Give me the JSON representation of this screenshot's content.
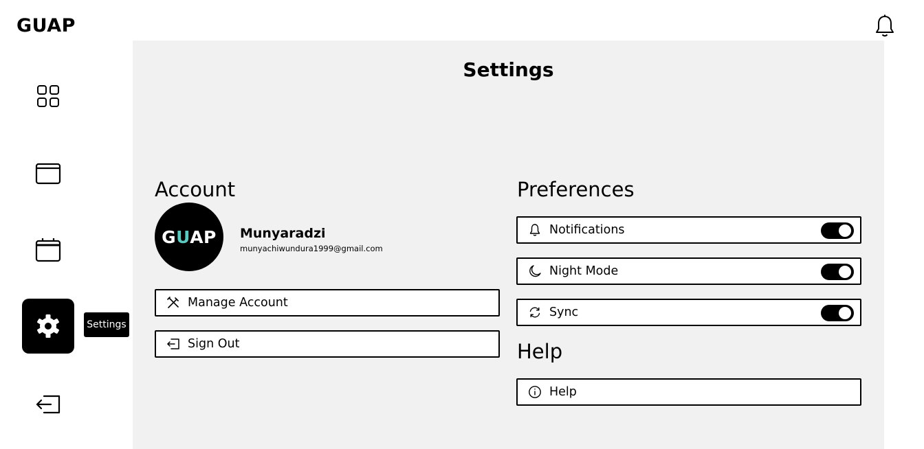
{
  "app": {
    "brand": "GUAP"
  },
  "sidebar": {
    "items": [
      {
        "icon": "dashboard-grid-icon",
        "active": false
      },
      {
        "icon": "wallet-icon",
        "active": false
      },
      {
        "icon": "calendar-icon",
        "active": false
      },
      {
        "icon": "gear-icon",
        "active": true
      },
      {
        "icon": "logout-icon",
        "active": false
      }
    ],
    "tooltip": "Settings"
  },
  "header": {
    "notification_icon": "bell-icon"
  },
  "main": {
    "title": "Settings",
    "account": {
      "heading": "Account",
      "avatar_text_prefix": "G",
      "avatar_text_accent": "U",
      "avatar_text_suffix": "AP",
      "name": "Munyaradzi",
      "email": "munyachiwundura1999@gmail.com",
      "actions": [
        {
          "label": "Manage Account",
          "icon": "tools-icon"
        },
        {
          "label": "Sign Out",
          "icon": "sign-out-icon"
        }
      ]
    },
    "preferences": {
      "heading": "Preferences",
      "items": [
        {
          "label": "Notifications",
          "icon": "bell-icon",
          "enabled": true
        },
        {
          "label": "Night Mode",
          "icon": "moon-icon",
          "enabled": true
        },
        {
          "label": "Sync",
          "icon": "sync-icon",
          "enabled": true
        }
      ]
    },
    "help": {
      "heading": "Help",
      "items": [
        {
          "label": "Help",
          "icon": "info-icon"
        }
      ]
    }
  },
  "colors": {
    "accent": "#5ec9be",
    "panel": "#f1f1f1",
    "ink": "#000000"
  }
}
